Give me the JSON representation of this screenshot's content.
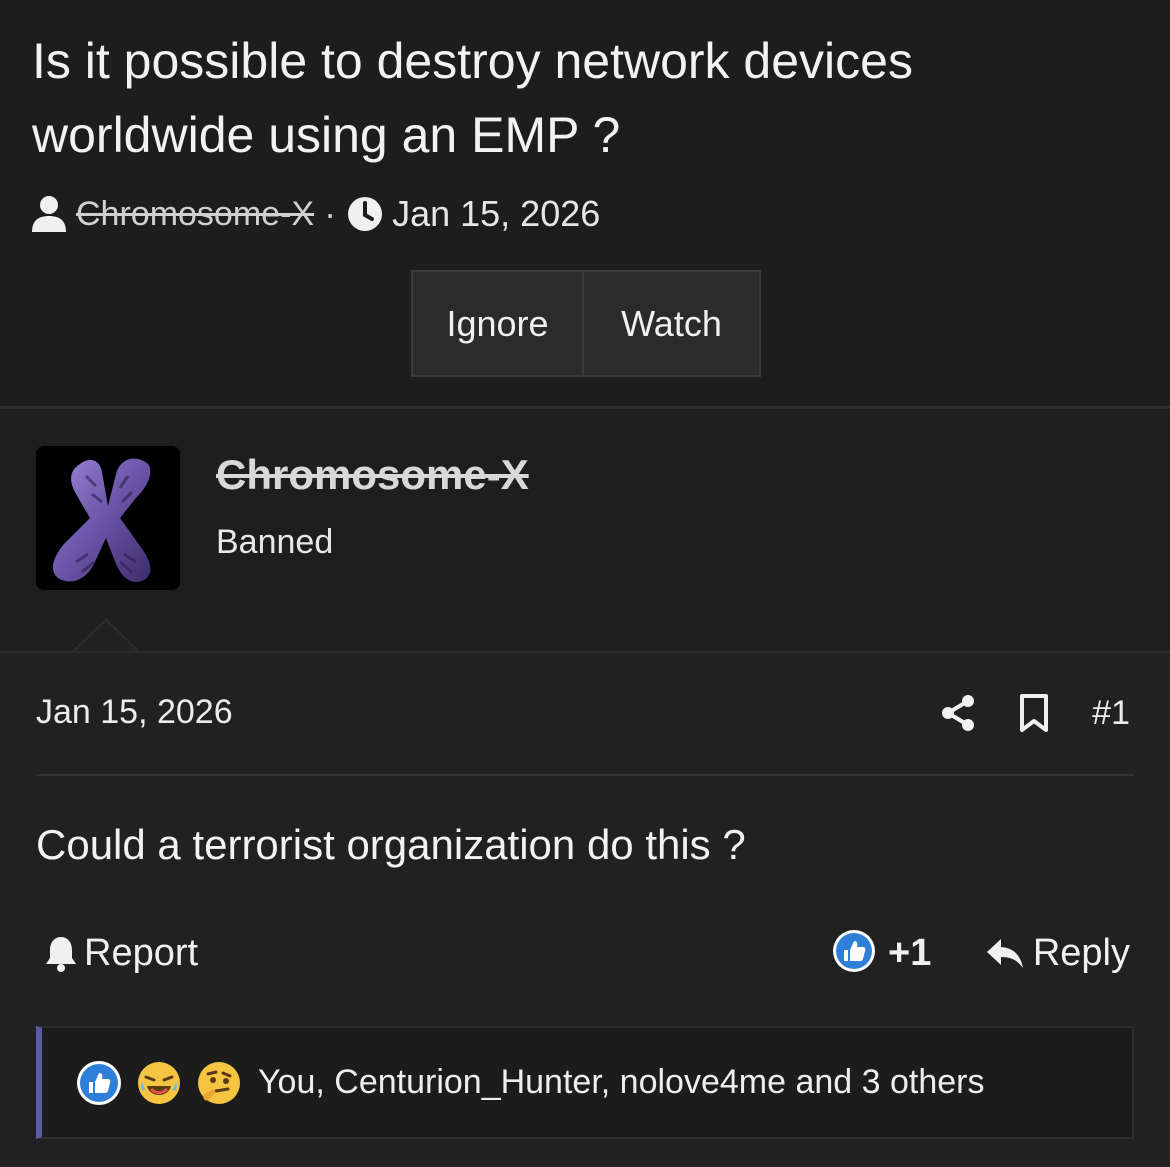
{
  "thread": {
    "title": "Is it possible to destroy network devices worldwide using an EMP ?",
    "author": "Chromosome-X",
    "separator": "·",
    "date": "Jan 15, 2026",
    "buttons": {
      "ignore": "Ignore",
      "watch": "Watch"
    }
  },
  "post": {
    "user_name": "Chromosome-X",
    "user_title": "Banned",
    "date": "Jan 15, 2026",
    "number": "#1",
    "text": "Could a terrorist organization do this ?",
    "report_label": "Report",
    "reaction_score": "+1",
    "reply_label": "Reply",
    "reactions_summary": "You, Centurion_Hunter, nolove4me and 3 others"
  },
  "icons": {
    "user": "user-icon",
    "clock": "clock-icon",
    "share": "share-icon",
    "bookmark": "bookmark-icon",
    "bell": "bell-icon",
    "like": "like-icon",
    "reply": "reply-arrow-icon",
    "haha": "haha-emoji-icon",
    "thinking": "thinking-emoji-icon"
  },
  "colors": {
    "background": "#1a1a1a",
    "accent_bar": "#5b5ea6",
    "like_blue": "#2f7fd8"
  }
}
